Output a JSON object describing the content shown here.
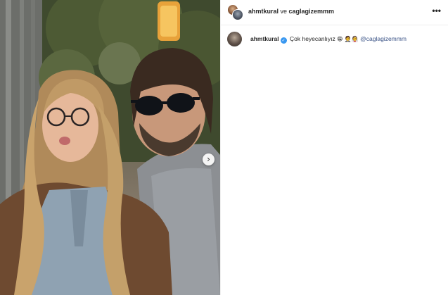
{
  "photo": {
    "carousel_next_glyph": "›"
  },
  "header": {
    "user1": "ahmtkural",
    "connector": " ve ",
    "user2": "caglagizemmm",
    "more_glyph": "•••"
  },
  "caption": {
    "username": "ahmtkural",
    "verified_glyph": "✓",
    "text": "Çok heyecanlıyız",
    "emoji1": "😁",
    "emoji2": "🤵👰",
    "mention": "@caglagizemmm"
  },
  "icons": [
    "carousel-next-icon",
    "more-options-icon",
    "verified-badge-icon"
  ],
  "colors": {
    "verified": "#3897f0",
    "mention": "#385185",
    "text": "#262626",
    "divider": "#efefef"
  }
}
